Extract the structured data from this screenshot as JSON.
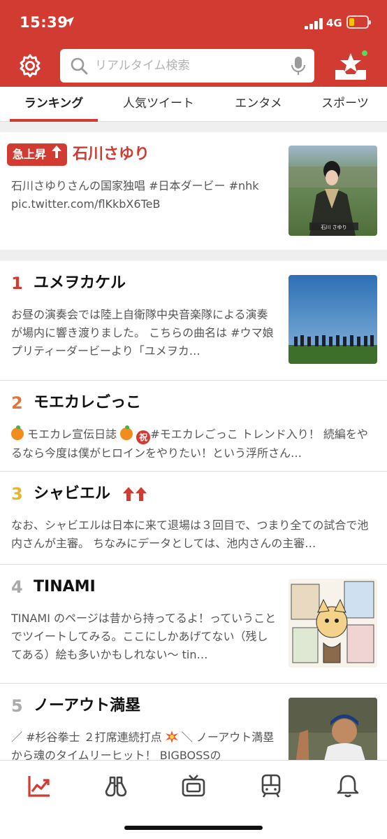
{
  "status_bar": {
    "time": "15:39",
    "network": "4G"
  },
  "search": {
    "placeholder": "リアルタイム検索"
  },
  "tabs": [
    {
      "label": "ランキング",
      "active": true
    },
    {
      "label": "人気ツイート"
    },
    {
      "label": "エンタメ"
    },
    {
      "label": "スポーツ"
    }
  ],
  "featured": {
    "badge": "急上昇",
    "title": "石川さゆり",
    "snippet_line1": "石川さゆりさんの国家独唱 #日本ダービー #nhk",
    "snippet_line2": "pic.twitter.com/flKkbX6TeB",
    "thumb_caption": "石川 さゆり"
  },
  "ranking": [
    {
      "rank": "1",
      "rank_color": "#d13b32",
      "title": "ユメヲカケル",
      "snippet": "お昼の演奏会では陸上自衛隊中央音楽隊による演奏が場内に響き渡りました。 こちらの曲名は #ウマ娘 プリティーダービーより「ユメヲカ…"
    },
    {
      "rank": "2",
      "rank_color": "#e0763c",
      "title": "モエカレごっこ",
      "snippet_a": "モエカレ宣伝日誌",
      "snippet_b": "#モエカレごっこ トレンド入り！ 続編をやるなら今度は僕がヒロインをやりたい！という浮所さん…"
    },
    {
      "rank": "3",
      "rank_color": "#e2b72a",
      "title": "シャビエル",
      "snippet": "なお、シャビエルは日本に来て退場は３回目で、つまり全ての試合で池内さんが主審。 ちなみにデータとしては、池内さんの主審…"
    },
    {
      "rank": "4",
      "rank_color": "#aaaaaa",
      "title": "TINAMI",
      "snippet": "TINAMI のページは昔から持ってるよ！っていうことでツイートしてみる。ここにしかあげてない（残してある）絵も多いかもしれない〜 tin…"
    },
    {
      "rank": "5",
      "rank_color": "#aaaaaa",
      "title": "ノーアウト満塁",
      "snippet_a": "／ #杉谷拳士 ２打席連続打点",
      "snippet_b": "＼ ノーアウト満塁から魂のタイムリーヒット！ BIGBOSSの"
    }
  ],
  "colors": {
    "brand_red": "#d13b32",
    "status_green": "#5cd65c",
    "battery_yellow": "#f5c400"
  },
  "bottom_nav": [
    "chart-icon",
    "binoculars-icon",
    "tv-icon",
    "train-icon",
    "bell-icon"
  ]
}
